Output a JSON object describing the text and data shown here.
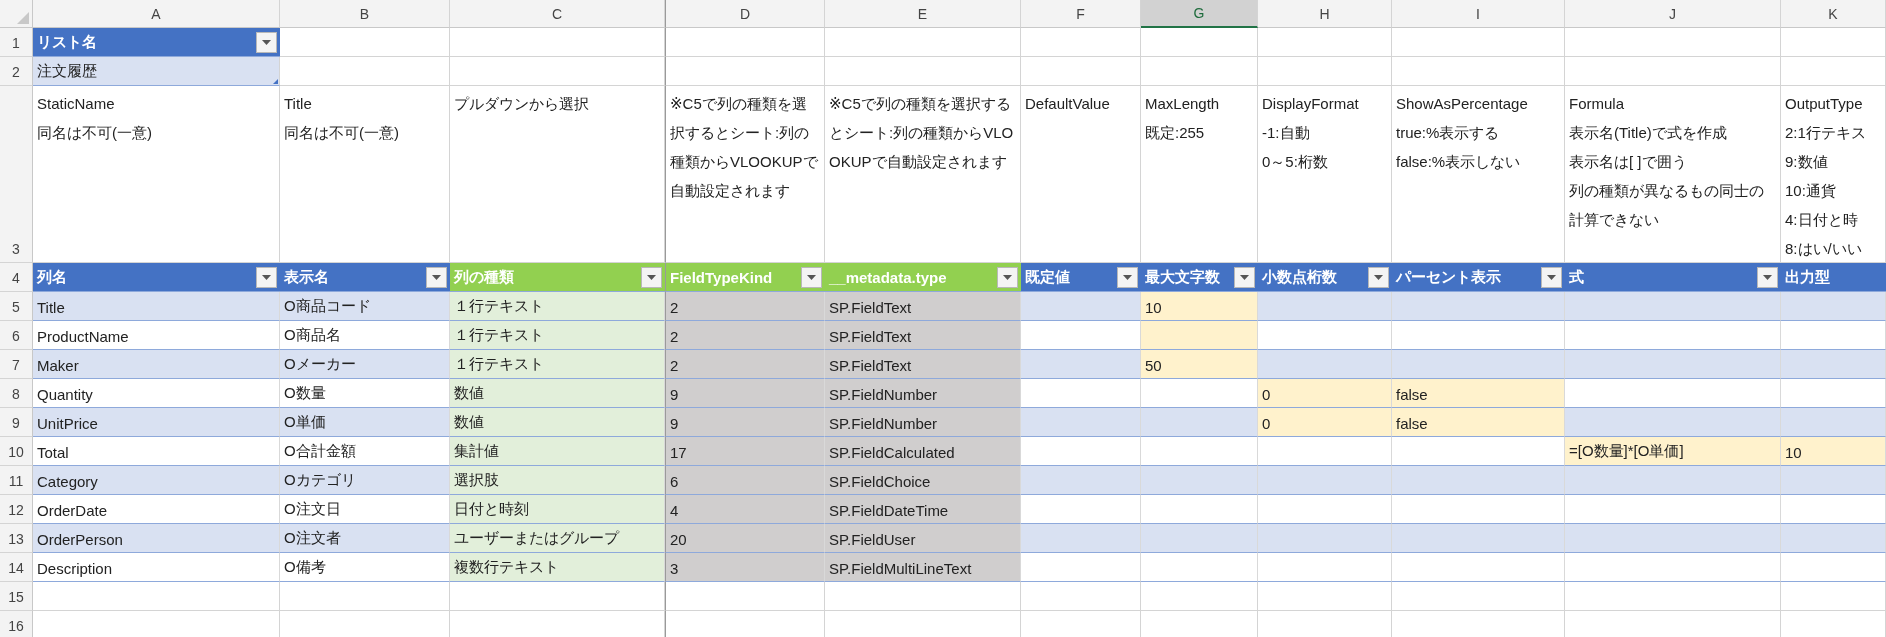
{
  "top_row_numbers": [
    "1",
    "2",
    "3",
    "4"
  ],
  "list_table": {
    "header": "リスト名",
    "value": "注文履歴"
  },
  "columns": [
    {
      "letter": "A",
      "selected": false,
      "kind": "input",
      "note": [
        "StaticName",
        "同名は不可(一意)"
      ],
      "header": "列名"
    },
    {
      "letter": "B",
      "selected": false,
      "kind": "input",
      "note": [
        "Title",
        "同名は不可(一意)"
      ],
      "header": "表示名"
    },
    {
      "letter": "C",
      "selected": false,
      "kind": "choice",
      "note": [
        "プルダウンから選択"
      ],
      "header": "列の種類"
    },
    {
      "letter": "D",
      "selected": false,
      "kind": "auto",
      "note": [
        "※C5で列の種類を選択するとシート:列の種類からVLOOKUPで自動設定されます"
      ],
      "header": "FieldTypeKind"
    },
    {
      "letter": "E",
      "selected": false,
      "kind": "auto",
      "note": [
        "※C5で列の種類を選択するとシート:列の種類からVLOOKUPで自動設定されます"
      ],
      "header": "__metadata.type"
    },
    {
      "letter": "F",
      "selected": false,
      "kind": "input",
      "note": [
        "DefaultValue"
      ],
      "header": "既定値"
    },
    {
      "letter": "G",
      "selected": true,
      "kind": "input",
      "note": [
        "MaxLength",
        "既定:255"
      ],
      "header": "最大文字数"
    },
    {
      "letter": "H",
      "selected": false,
      "kind": "input",
      "note": [
        "DisplayFormat",
        "-1:自動",
        "0～5:桁数"
      ],
      "header": "小数点桁数"
    },
    {
      "letter": "I",
      "selected": false,
      "kind": "input",
      "note": [
        "ShowAsPercentage",
        "true:%表示する",
        "false:%表示しない"
      ],
      "header": "パーセント表示"
    },
    {
      "letter": "J",
      "selected": false,
      "kind": "input",
      "note": [
        "Formula",
        "表示名(Title)で式を作成",
        "表示名は[ ]で囲う",
        "列の種類が異なるもの同士の計算できない"
      ],
      "header": "式"
    },
    {
      "letter": "K",
      "selected": false,
      "kind": "input",
      "note": [
        "OutputType",
        "2:1行テキス",
        "9:数値",
        "10:通貨",
        "4:日付と時",
        "8:はい/いい"
      ],
      "header": "出力型"
    }
  ],
  "rows": [
    {
      "number": "5",
      "cells": [
        "Title",
        "O商品コード",
        "１行テキスト",
        "2",
        "SP.FieldText",
        null,
        "10",
        null,
        null,
        null,
        null
      ],
      "highlighted": [
        false,
        false,
        false,
        false,
        false,
        false,
        true,
        false,
        false,
        false,
        false
      ]
    },
    {
      "number": "6",
      "cells": [
        "ProductName",
        "O商品名",
        "１行テキスト",
        "2",
        "SP.FieldText",
        null,
        null,
        null,
        null,
        null,
        null
      ],
      "highlighted": [
        false,
        false,
        false,
        false,
        false,
        false,
        true,
        false,
        false,
        false,
        false
      ]
    },
    {
      "number": "7",
      "cells": [
        "Maker",
        "Oメーカー",
        "１行テキスト",
        "2",
        "SP.FieldText",
        null,
        "50",
        null,
        null,
        null,
        null
      ],
      "highlighted": [
        false,
        false,
        false,
        false,
        false,
        false,
        true,
        false,
        false,
        false,
        false
      ]
    },
    {
      "number": "8",
      "cells": [
        "Quantity",
        "O数量",
        "数値",
        "9",
        "SP.FieldNumber",
        null,
        null,
        "0",
        "false",
        null,
        null
      ],
      "highlighted": [
        false,
        false,
        false,
        false,
        false,
        false,
        false,
        true,
        true,
        false,
        false
      ]
    },
    {
      "number": "9",
      "cells": [
        "UnitPrice",
        "O単価",
        "数値",
        "9",
        "SP.FieldNumber",
        null,
        null,
        "0",
        "false",
        null,
        null
      ],
      "highlighted": [
        false,
        false,
        false,
        false,
        false,
        false,
        false,
        true,
        true,
        false,
        false
      ]
    },
    {
      "number": "10",
      "cells": [
        "Total",
        "O合計金額",
        "集計値",
        "17",
        "SP.FieldCalculated",
        null,
        null,
        null,
        null,
        "=[O数量]*[O単価]",
        "10"
      ],
      "highlighted": [
        false,
        false,
        false,
        false,
        false,
        false,
        false,
        false,
        false,
        true,
        true
      ]
    },
    {
      "number": "11",
      "cells": [
        "Category",
        "Oカテゴリ",
        "選択肢",
        "6",
        "SP.FieldChoice",
        null,
        null,
        null,
        null,
        null,
        null
      ],
      "highlighted": [
        false,
        false,
        false,
        false,
        false,
        false,
        false,
        false,
        false,
        false,
        false
      ]
    },
    {
      "number": "12",
      "cells": [
        "OrderDate",
        "O注文日",
        "日付と時刻",
        "4",
        "SP.FieldDateTime",
        null,
        null,
        null,
        null,
        null,
        null
      ],
      "highlighted": [
        false,
        false,
        false,
        false,
        false,
        false,
        false,
        false,
        false,
        false,
        false
      ]
    },
    {
      "number": "13",
      "cells": [
        "OrderPerson",
        "O注文者",
        "ユーザーまたはグループ",
        "20",
        "SP.FieldUser",
        null,
        null,
        null,
        null,
        null,
        null
      ],
      "highlighted": [
        false,
        false,
        false,
        false,
        false,
        false,
        false,
        false,
        false,
        false,
        false
      ]
    },
    {
      "number": "14",
      "cells": [
        "Description",
        "O備考",
        "複数行テキスト",
        "3",
        "SP.FieldMultiLineText",
        null,
        null,
        null,
        null,
        null,
        null
      ],
      "highlighted": [
        false,
        false,
        false,
        false,
        false,
        false,
        false,
        false,
        false,
        false,
        false
      ]
    }
  ],
  "empty_rows": [
    "15",
    "16"
  ]
}
